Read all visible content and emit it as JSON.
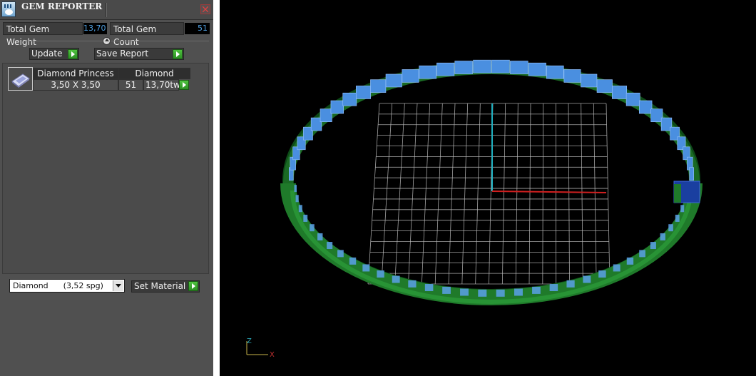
{
  "panel": {
    "title": "GEM REPORTER",
    "close_icon": "close-icon",
    "stats": {
      "weight_label": "Total Gem Weight",
      "weight_value": "13,70",
      "count_label": "Total Gem Count",
      "count_value": "51"
    },
    "buttons": {
      "update_label": "Update",
      "save_label": "Save Report"
    },
    "gem_row": {
      "name": "Diamond Princess",
      "material": "Diamond",
      "size": "3,50 X 3,50",
      "count": "51",
      "weight": "13,70tw"
    },
    "material_select": {
      "value": "Diamond      (3,52 spg)"
    },
    "set_material_label": "Set Material"
  },
  "viewport": {
    "axis_z_label": "Z",
    "axis_x_label": "X",
    "colors": {
      "ring": "#1f7a2a",
      "gems": "#4a8fe0",
      "grid": "#bfbfbf",
      "axis_x": "#d02020",
      "axis_y": "#20b0c0"
    }
  }
}
